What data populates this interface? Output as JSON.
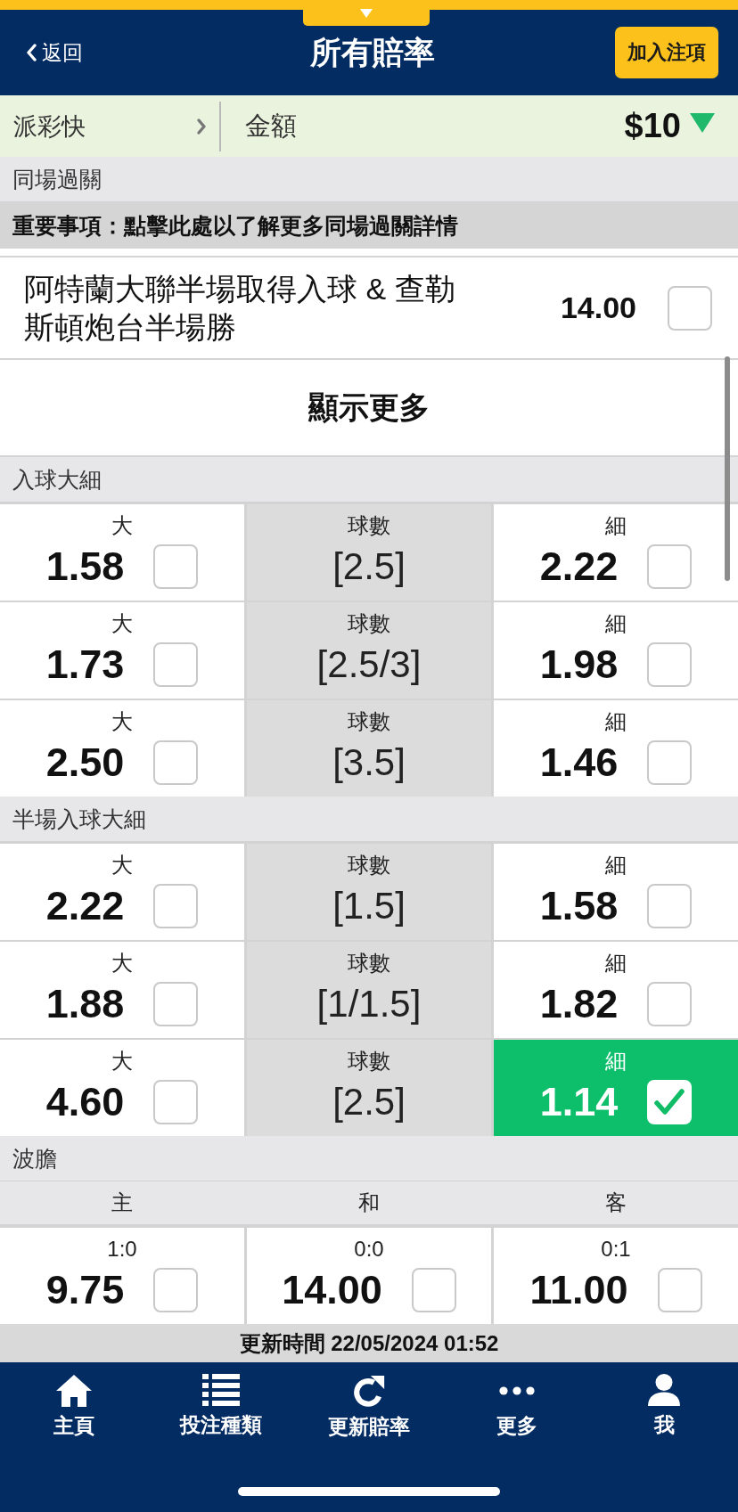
{
  "header": {
    "back": "返回",
    "title": "所有賠率",
    "action": "加入注項"
  },
  "quick_bar": {
    "quick_payout": "派彩快",
    "amount_label": "金額",
    "amount": "$10"
  },
  "same_game": {
    "title": "同場過關",
    "notice": "重要事項：點擊此處以了解更多同場過關詳情",
    "selections": [
      {
        "name": "阿特蘭大聯半場取得入球 & 查勒斯頓炮台半場勝",
        "odds": "14.00",
        "checked": false
      }
    ],
    "show_more": "顯示更多"
  },
  "markets": [
    {
      "kind": "hilo",
      "title": "入球大細",
      "lines": [
        {
          "high": {
            "label": "大",
            "odds": "1.58",
            "checked": false
          },
          "line": {
            "label": "球數",
            "value": "[2.5]"
          },
          "low": {
            "label": "細",
            "odds": "2.22",
            "checked": false
          }
        },
        {
          "high": {
            "label": "大",
            "odds": "1.73",
            "checked": false
          },
          "line": {
            "label": "球數",
            "value": "[2.5/3]"
          },
          "low": {
            "label": "細",
            "odds": "1.98",
            "checked": false
          }
        },
        {
          "high": {
            "label": "大",
            "odds": "2.50",
            "checked": false
          },
          "line": {
            "label": "球數",
            "value": "[3.5]"
          },
          "low": {
            "label": "細",
            "odds": "1.46",
            "checked": false
          }
        }
      ]
    },
    {
      "kind": "hilo",
      "title": "半場入球大細",
      "lines": [
        {
          "high": {
            "label": "大",
            "odds": "2.22",
            "checked": false
          },
          "line": {
            "label": "球數",
            "value": "[1.5]"
          },
          "low": {
            "label": "細",
            "odds": "1.58",
            "checked": false
          }
        },
        {
          "high": {
            "label": "大",
            "odds": "1.88",
            "checked": false
          },
          "line": {
            "label": "球數",
            "value": "[1/1.5]"
          },
          "low": {
            "label": "細",
            "odds": "1.82",
            "checked": false
          }
        },
        {
          "high": {
            "label": "大",
            "odds": "4.60",
            "checked": false
          },
          "line": {
            "label": "球數",
            "value": "[2.5]"
          },
          "low": {
            "label": "細",
            "odds": "1.14",
            "checked": true
          }
        }
      ]
    },
    {
      "kind": "correct_score",
      "title": "波膽",
      "columns": [
        "主",
        "和",
        "客"
      ],
      "cells": [
        {
          "score": "1:0",
          "odds": "9.75",
          "checked": false
        },
        {
          "score": "0:0",
          "odds": "14.00",
          "checked": false
        },
        {
          "score": "0:1",
          "odds": "11.00",
          "checked": false
        }
      ]
    }
  ],
  "updated": "更新時間 22/05/2024 01:52",
  "nav": [
    {
      "label": "主頁"
    },
    {
      "label": "投注種類"
    },
    {
      "label": "更新賠率"
    },
    {
      "label": "更多"
    },
    {
      "label": "我"
    }
  ]
}
